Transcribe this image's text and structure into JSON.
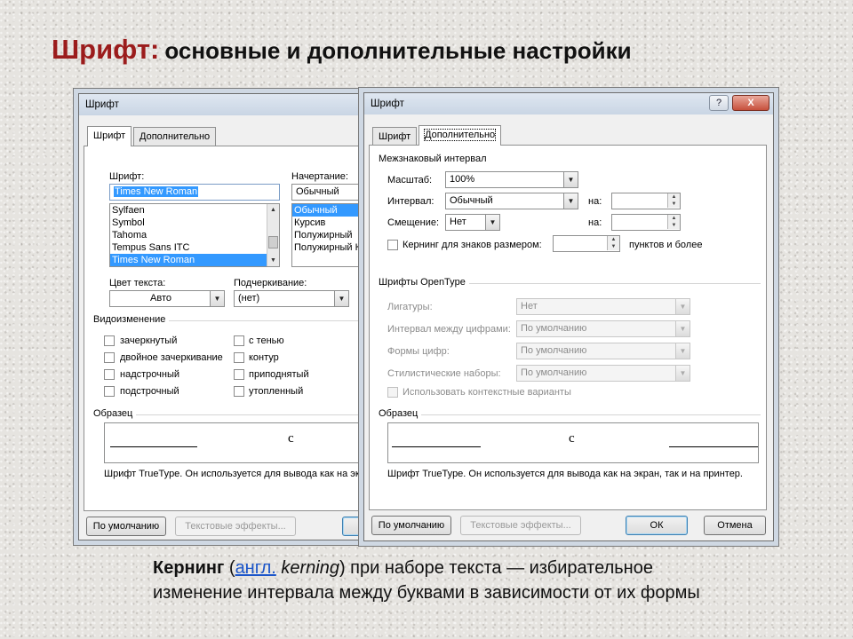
{
  "slide": {
    "title_main": "Шрифт:",
    "title_rest": "основные и дополнительные  настройки"
  },
  "dialog_left": {
    "title": "Шрифт",
    "tabs": [
      "Шрифт",
      "Дополнительно"
    ],
    "font_label": "Шрифт:",
    "font_value": "Times New Roman",
    "font_list": [
      "Sylfaen",
      "Symbol",
      "Tahoma",
      "Tempus Sans ITC",
      "Times New Roman"
    ],
    "font_list_selected": 4,
    "style_label": "Начертание:",
    "style_value": "Обычный",
    "style_list": [
      "Обычный",
      "Курсив",
      "Полужирный",
      "Полужирный К"
    ],
    "style_list_selected": 0,
    "color_label": "Цвет текста:",
    "color_value": "Авто",
    "underline_label": "Подчеркивание:",
    "underline_value": "(нет)",
    "effects_label": "Видоизменение",
    "effects_col1": [
      "зачеркнутый",
      "двойное зачеркивание",
      "надстрочный",
      "подстрочный"
    ],
    "effects_col2": [
      "с тенью",
      "контур",
      "приподнятый",
      "утопленный"
    ],
    "sample_label": "Образец",
    "sample_char": "c",
    "sample_note": "Шрифт TrueType. Он используется для вывода как на экр",
    "btn_default": "По умолчанию",
    "btn_effects": "Текстовые эффекты..."
  },
  "dialog_right": {
    "title": "Шрифт",
    "help": "?",
    "close": "X",
    "tabs": [
      "Шрифт",
      "Дополнительно"
    ],
    "spacing_section": "Межзнаковый интервал",
    "scale_label": "Масштаб:",
    "scale_value": "100%",
    "interval_label": "Интервал:",
    "interval_value": "Обычный",
    "interval_by_label": "на:",
    "offset_label": "Смещение:",
    "offset_value": "Нет",
    "offset_by_label": "на:",
    "kerning_label": "Кернинг для знаков размером:",
    "kerning_suffix": "пунктов и более",
    "opentype_section": "Шрифты OpenType",
    "ligatures_label": "Лигатуры:",
    "ligatures_value": "Нет",
    "num_spacing_label": "Интервал между цифрами:",
    "num_spacing_value": "По умолчанию",
    "num_forms_label": "Формы цифр:",
    "num_forms_value": "По умолчанию",
    "stylistic_label": "Стилистические наборы:",
    "stylistic_value": "По умолчанию",
    "contextual_label": "Использовать контекстные варианты",
    "sample_label": "Образец",
    "sample_char": "c",
    "sample_note": "Шрифт TrueType. Он используется для вывода как на экран, так и на принтер.",
    "btn_default": "По умолчанию",
    "btn_effects": "Текстовые эффекты...",
    "btn_ok": "ОК",
    "btn_cancel": "Отмена"
  },
  "caption": {
    "term": "Кернинг",
    "open_paren": " (",
    "lang_link": "англ.",
    "english": " kerning",
    "rest_line1": ") при наборе текста — избирательное",
    "line2": "изменение интервала между буквами в зависимости от их формы"
  }
}
